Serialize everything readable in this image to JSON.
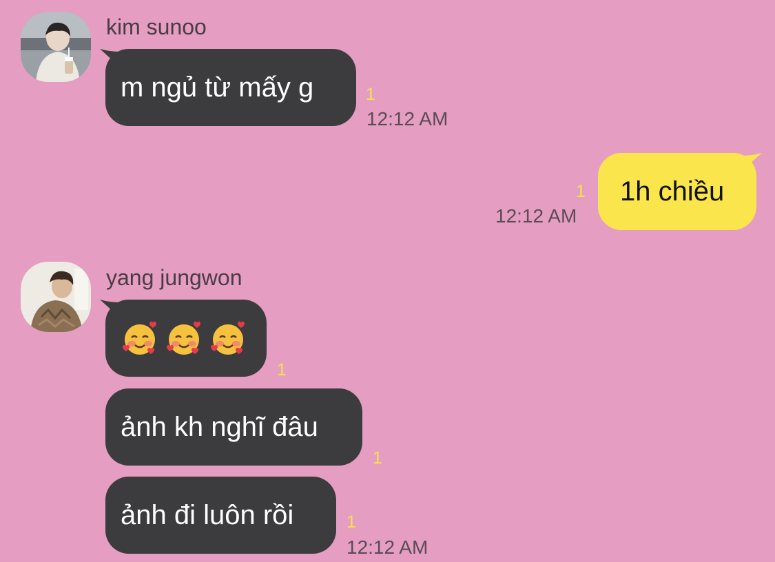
{
  "messages": [
    {
      "sender": "kim sunoo",
      "avatar_icon": "profile-photo-kim-sunoo",
      "text": "m ngủ từ mấy g",
      "unread": "1",
      "time": "12:12 AM"
    },
    {
      "sender": "me",
      "text": "1h chiều",
      "unread": "1",
      "time": "12:12 AM"
    },
    {
      "sender": "yang jungwon",
      "avatar_icon": "profile-photo-yang-jungwon",
      "bubbles": [
        {
          "emojis": [
            "smiling-face-with-hearts-emoji",
            "smiling-face-with-hearts-emoji",
            "smiling-face-with-hearts-emoji"
          ],
          "unread": "1"
        },
        {
          "text": "ảnh kh nghĩ đâu",
          "unread": "1"
        },
        {
          "text": "ảnh đi luôn rồi",
          "unread": "1"
        }
      ],
      "time": "12:12 AM"
    }
  ],
  "colors": {
    "background": "#e59ec2",
    "incoming_bubble": "#3c3c3e",
    "outgoing_bubble": "#fbe54d",
    "unread_count": "#f6e24a"
  }
}
